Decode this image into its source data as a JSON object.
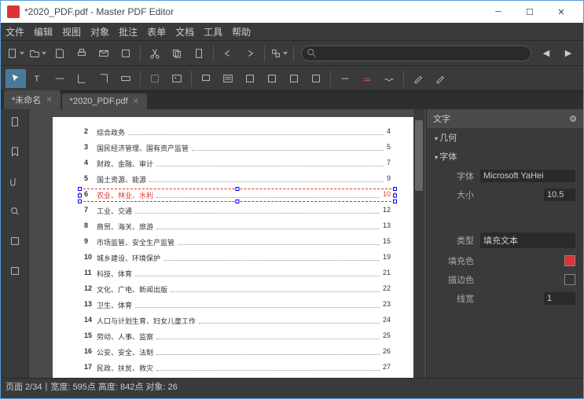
{
  "window": {
    "title": "*2020_PDF.pdf - Master PDF Editor"
  },
  "menu": [
    "文件",
    "编辑",
    "视图",
    "对象",
    "批注",
    "表单",
    "文档",
    "工具",
    "帮助"
  ],
  "tabs": [
    {
      "label": "*未命名"
    },
    {
      "label": "*2020_PDF.pdf"
    }
  ],
  "toc": [
    {
      "n": "2",
      "t": "综合政务",
      "p": "4"
    },
    {
      "n": "3",
      "t": "国民经济管理、国有资产监管",
      "p": "5"
    },
    {
      "n": "4",
      "t": "财政、金融、审计",
      "p": "7"
    },
    {
      "n": "5",
      "t": "国土资源、能源",
      "p": "9"
    },
    {
      "n": "6",
      "t": "农业、林业、水利",
      "p": "10",
      "sel": true
    },
    {
      "n": "7",
      "t": "工业、交通",
      "p": "12"
    },
    {
      "n": "8",
      "t": "商贸、海关、旅游",
      "p": "13"
    },
    {
      "n": "9",
      "t": "市场监管、安全生产监管",
      "p": "15"
    },
    {
      "n": "10",
      "t": "城乡建设、环境保护",
      "p": "19"
    },
    {
      "n": "11",
      "t": "科技、体育",
      "p": "21"
    },
    {
      "n": "12",
      "t": "文化、广电、新闻出版",
      "p": "22"
    },
    {
      "n": "13",
      "t": "卫生、体育",
      "p": "23"
    },
    {
      "n": "14",
      "t": "人口与计划生育、妇女儿童工作",
      "p": "24"
    },
    {
      "n": "15",
      "t": "劳动、人事、监察",
      "p": "25"
    },
    {
      "n": "16",
      "t": "公安、安全、法制",
      "p": "26"
    },
    {
      "n": "17",
      "t": "民政、扶贫、救灾",
      "p": "27"
    }
  ],
  "props": {
    "title": "文字",
    "sec_geom": "几何",
    "sec_font": "字体",
    "font_lbl": "字体",
    "font_val": "Microsoft YaHei",
    "size_lbl": "大小",
    "size_val": "10.5",
    "type_lbl": "类型",
    "type_val": "填充文本",
    "fill_lbl": "填充色",
    "fill_val": "#d33333",
    "stroke_lbl": "描边色",
    "stroke_val": "#333333",
    "lw_lbl": "线宽",
    "lw_val": "1"
  },
  "status": {
    "page": "页面 2/34",
    "w": "宽度: 595点",
    "h": "高度: 842点",
    "obj": "对象: 26"
  }
}
